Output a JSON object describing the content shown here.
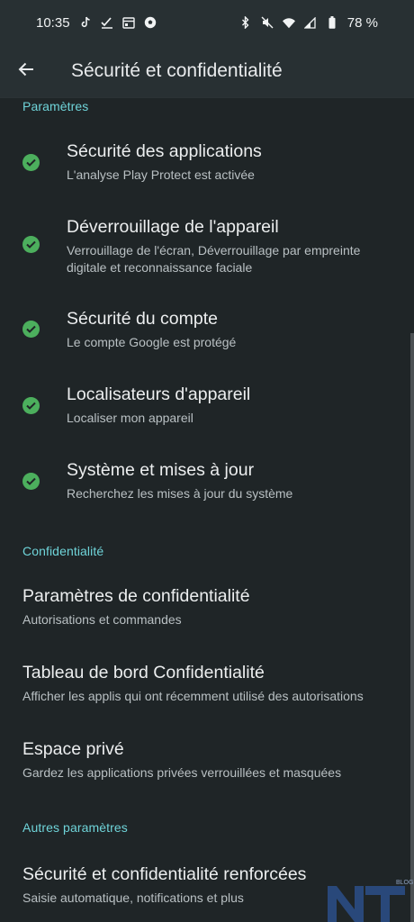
{
  "status_bar": {
    "time": "10:35",
    "battery": "78 %",
    "icons_left": [
      "tiktok-icon",
      "checklist-icon",
      "calendar-icon",
      "soccer-icon"
    ],
    "icons_right": [
      "bluetooth-icon",
      "mute-icon",
      "wifi-icon",
      "signal-icon",
      "battery-icon"
    ]
  },
  "app_bar": {
    "title": "Sécurité et confidentialité"
  },
  "sections": {
    "parametres": {
      "header": "Paramètres",
      "items": [
        {
          "title": "Sécurité des applications",
          "subtitle": "L'analyse Play Protect est activée"
        },
        {
          "title": "Déverrouillage de l'appareil",
          "subtitle_line1": "Verrouillage de l'écran, Déverrouillage par empreinte",
          "subtitle_line2": "digitale et reconnaissance faciale"
        },
        {
          "title": "Sécurité du compte",
          "subtitle": "Le compte Google est protégé"
        },
        {
          "title": "Localisateurs d'appareil",
          "subtitle": "Localiser mon appareil"
        },
        {
          "title": "Système et mises à jour",
          "subtitle": "Recherchez les mises à jour du système"
        }
      ]
    },
    "confidentialite": {
      "header": "Confidentialité",
      "items": [
        {
          "title": "Paramètres de confidentialité",
          "subtitle": "Autorisations et commandes"
        },
        {
          "title": "Tableau de bord Confidentialité",
          "subtitle": "Afficher les applis qui ont récemment utilisé des autorisations"
        },
        {
          "title": "Espace privé",
          "subtitle": "Gardez les applications privées verrouillées et masquées"
        }
      ]
    },
    "autres": {
      "header": "Autres paramètres",
      "items": [
        {
          "title": "Sécurité et confidentialité renforcées",
          "subtitle": "Saisie automatique, notifications et plus"
        }
      ]
    }
  },
  "watermark": {
    "text": "BLOG"
  },
  "colors": {
    "accent": "#6fd4d9",
    "check": "#4caf5d",
    "background": "#1f2527",
    "bar": "#283033"
  }
}
